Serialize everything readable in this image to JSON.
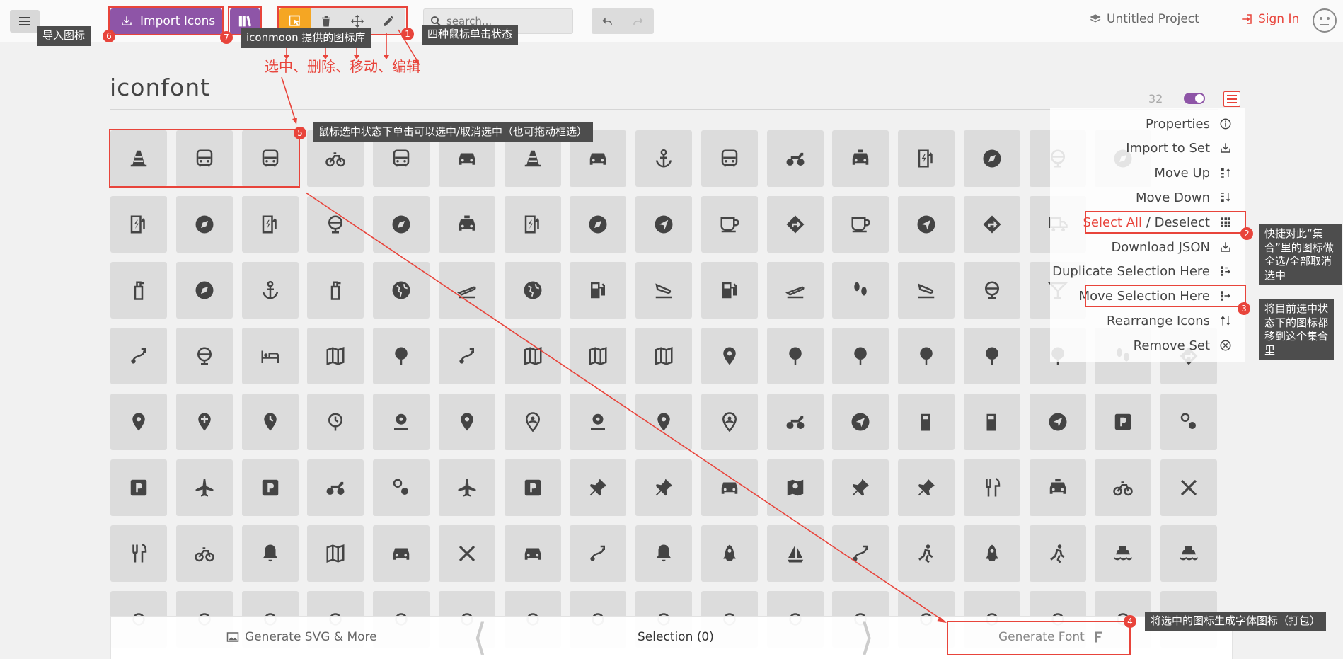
{
  "header": {
    "import_label": "Import Icons",
    "search_placeholder": "search...",
    "project_label": "Untitled Project",
    "signin_label": "Sign In"
  },
  "set": {
    "title": "iconfont",
    "count": "32"
  },
  "menu": {
    "properties": "Properties",
    "import_to_set": "Import to Set",
    "move_up": "Move Up",
    "move_down": "Move Down",
    "select_all": "Select All",
    "separator": " / ",
    "deselect": "Deselect",
    "download_json": "Download JSON",
    "duplicate_selection": "Duplicate Selection Here",
    "move_selection": "Move Selection Here",
    "rearrange": "Rearrange Icons",
    "remove_set": "Remove Set"
  },
  "footer": {
    "generate_svg": "Generate SVG & More",
    "selection": "Selection (0)",
    "generate_font": "Generate Font"
  },
  "annotations": {
    "import_tip": "导入图标",
    "library_tip": "iconmoon 提供的图标库",
    "modes_tip": "四种鼠标单击状态",
    "modes_caption": "选中、删除、移动、编辑",
    "select_tip": "鼠标选中状态下单击可以选中/取消选中（也可拖动框选）",
    "select_all_tip": "快捷对此“集合”里的图标做 全选/全部取消选中",
    "move_tip": "将目前选中状态下的图标都移到这个集合里",
    "font_tip": "将选中的图标生成字体图标（打包）",
    "badges": [
      "1",
      "2",
      "3",
      "4",
      "5",
      "6",
      "7"
    ]
  },
  "icons": [
    "traffic-cone",
    "bus",
    "bus",
    "bicycle",
    "bus",
    "car",
    "traffic-cone",
    "car",
    "anchor",
    "bus",
    "motorcycle",
    "taxi",
    "ev-station",
    "compass",
    "globe",
    "compass",
    "",
    "ev-station",
    "compass",
    "ev-station",
    "globe",
    "compass",
    "taxi",
    "ev-station",
    "compass",
    "navigation",
    "coffee",
    "directions",
    "coffee",
    "navigation",
    "directions",
    "delivery",
    "",
    "",
    "fire-extinguisher",
    "compass",
    "anchor",
    "fire-extinguisher",
    "earth",
    "flight-takeoff",
    "earth",
    "gas-station",
    "flight-land",
    "gas-station",
    "flight-takeoff",
    "footprint",
    "flight-land",
    "globe",
    "cocktail",
    "",
    "",
    "route",
    "globe",
    "hotel",
    "map",
    "pin",
    "route",
    "map",
    "map",
    "map",
    "place",
    "pin",
    "pin",
    "pin",
    "pin",
    "pin",
    "footprint",
    "directions",
    "place",
    "add-location",
    "schedule-location",
    "schedule",
    "pin-drop",
    "place",
    "person-pin",
    "pin-drop",
    "place",
    "person-pin",
    "motorcycle",
    "navigation",
    "fuel",
    "fuel",
    "navigation",
    "parking",
    "location-pair",
    "parking",
    "airplane",
    "parking",
    "motorcycle",
    "location-pair",
    "airplane",
    "parking",
    "pushpin",
    "pushpin",
    "car",
    "map-pin",
    "pushpin",
    "pushpin",
    "restaurant",
    "taxi",
    "bicycle",
    "cutlery",
    "restaurant",
    "bicycle",
    "bell",
    "map",
    "car",
    "cutlery",
    "car",
    "route",
    "bell",
    "rocket",
    "sailboat",
    "route",
    "run",
    "rocket",
    "run",
    "ship",
    "ship",
    "beacon",
    "beacon",
    "beacon",
    "beacon",
    "beacon",
    "beacon",
    "beacon",
    "beacon",
    "beacon",
    "beacon",
    "beacon",
    "beacon",
    "beacon",
    "beacon",
    "beacon",
    "beacon",
    "beacon"
  ],
  "colors": {
    "accent": "#8e55a7",
    "active_tool": "#f5a623",
    "annotation": "#e8443b",
    "tile": "#dcdcdc"
  }
}
